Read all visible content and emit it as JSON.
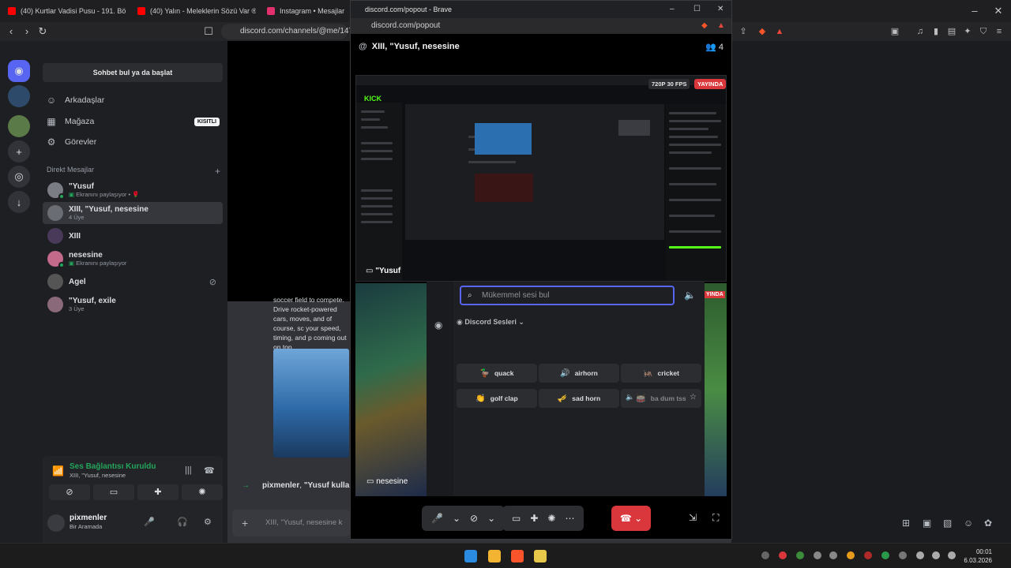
{
  "browser": {
    "tabs": [
      {
        "title": "(40) Kurtlar Vadisi Pusu - 191. Bölüm",
        "color": "#ff0000"
      },
      {
        "title": "(40) Yalın - Meleklerin Sözü Var ®",
        "color": "#ff0000"
      },
      {
        "title": "Instagram • Mesajlar",
        "color": "#e1306c"
      }
    ],
    "url": "discord.com/channels/@me/1479"
  },
  "servers": {
    "icons": [
      "discord-home-icon",
      "add-server-icon",
      "explore-icon",
      "download-icon"
    ]
  },
  "sidebar": {
    "search_label": "Sohbet bul ya da başlat",
    "nav": [
      {
        "label": "Arkadaşlar",
        "icon": "friends-icon"
      },
      {
        "label": "Mağaza",
        "icon": "store-icon",
        "badge": "KISITLI"
      },
      {
        "label": "Görevler",
        "icon": "quests-icon"
      }
    ],
    "dm_header": "Direkt Mesajlar",
    "dms": [
      {
        "name": "\"Yusuf",
        "sub": "Ekranını paylaşıyor • "
      },
      {
        "name": "XIII, \"Yusuf, nesesine",
        "sub": "4 Üye",
        "selected": true
      },
      {
        "name": "XIII",
        "sub": ""
      },
      {
        "name": "nesesine",
        "sub": "Ekranını paylaşıyor"
      },
      {
        "name": "Agel",
        "sub": ""
      },
      {
        "name": "\"Yusuf, exile",
        "sub": "3 Üye"
      }
    ]
  },
  "voice": {
    "title": "Ses Bağlantısı Kuruldu",
    "sub": "XIII, \"Yusuf, nesesine"
  },
  "user": {
    "name": "pixmenler",
    "status": "Bir Aramada"
  },
  "chat": {
    "message_text": "soccer field to compete. Drive rocket-powered cars, moves, and of course, sc your speed, timing, and p coming out on top.",
    "join_user": "pixmenler",
    "join_text": "\"Yusuf kulla",
    "input_placeholder": "XIII, \"Yusuf, nesesine k"
  },
  "popout": {
    "window_title": "discord.com/popout - Brave",
    "address": "discord.com/popout",
    "header": "XIII, \"Yusuf, nesesine",
    "member_count": "4",
    "stream_quality": "720P 30 FPS",
    "live_label": "YAYINDA",
    "streamer": "\"Yusuf",
    "game_user": "nesesine",
    "kick_logo": "KICK",
    "live_label_2": "YINDA"
  },
  "soundboard": {
    "search_placeholder": "Mükemmel sesi bul",
    "category": "Discord Sesleri",
    "sounds": [
      {
        "label": "quack",
        "emoji": "🦆"
      },
      {
        "label": "airhorn",
        "emoji": "🔊"
      },
      {
        "label": "cricket",
        "emoji": "🦗"
      },
      {
        "label": "golf clap",
        "emoji": "👏"
      },
      {
        "label": "sad horn",
        "emoji": "🎺"
      },
      {
        "label": "ba dum tss",
        "emoji": "🥁"
      }
    ]
  },
  "taskbar": {
    "time": "00:01",
    "date": "6.03.2026"
  }
}
